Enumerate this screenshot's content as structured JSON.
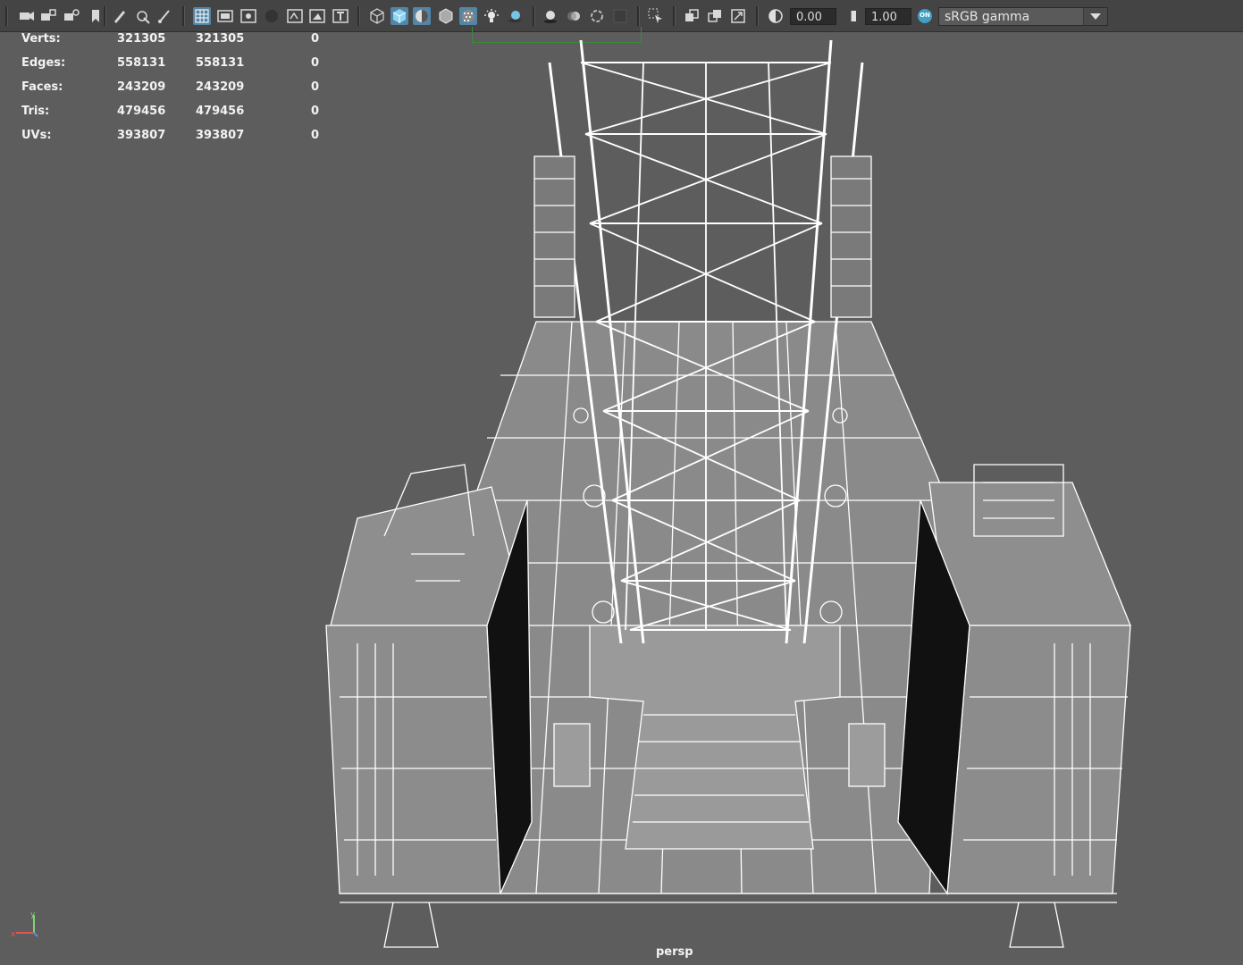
{
  "toolbar": {
    "exposure_value": "0.00",
    "gamma_value": "1.00",
    "color_space": "sRGB gamma",
    "color_mgmt_badge": "ON",
    "icons": [
      "camera-icon",
      "camera-lock-icon",
      "camera-attr-icon",
      "bookmark-icon",
      "pen-icon",
      "grease-pencil-icon",
      "brush-icon",
      "grid-icon",
      "film-gate-icon",
      "resolution-gate-icon",
      "gate-mask-icon",
      "field-chart-icon",
      "safe-action-icon",
      "safe-title-icon",
      "wireframe-icon",
      "smooth-shade-icon",
      "default-material-icon",
      "shade-wireframe-icon",
      "textured-icon",
      "lights-icon",
      "shadows-icon",
      "ambient-occlusion-icon",
      "motion-blur-icon",
      "anti-alias-icon",
      "depth-of-field-icon",
      "select-camera-icon",
      "isolate-icon",
      "xray-icon",
      "xray-joints-icon",
      "exposure-icon",
      "gamma-icon",
      "color-management-icon"
    ]
  },
  "hud": {
    "rows": [
      {
        "label": "Verts:",
        "a": "321305",
        "b": "321305",
        "c": "0"
      },
      {
        "label": "Edges:",
        "a": "558131",
        "b": "558131",
        "c": "0"
      },
      {
        "label": "Faces:",
        "a": "243209",
        "b": "243209",
        "c": "0"
      },
      {
        "label": "Tris:",
        "a": "479456",
        "b": "479456",
        "c": "0"
      },
      {
        "label": "UVs:",
        "a": "393807",
        "b": "393807",
        "c": "0"
      }
    ]
  },
  "viewport": {
    "camera_label": "persp",
    "axis_x": "x",
    "axis_y": "y",
    "background_color": "#5d5d5d",
    "wire_color": "#ffffff"
  }
}
